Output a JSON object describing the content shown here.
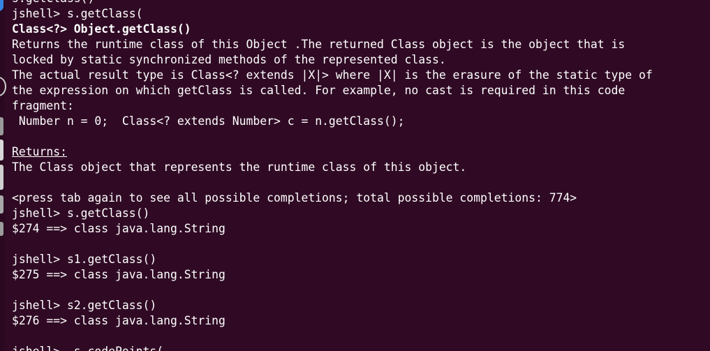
{
  "terminal": {
    "lines": [
      {
        "text": "s.getClass()",
        "style": "partial"
      },
      {
        "text": "jshell> s.getClass(",
        "style": "normal"
      },
      {
        "text": "Class<?> Object.getClass()",
        "style": "bold"
      },
      {
        "text": "Returns the runtime class of this Object .The returned Class object is the object that is",
        "style": "normal"
      },
      {
        "text": "locked by static synchronized methods of the represented class.",
        "style": "normal"
      },
      {
        "text": "The actual result type is Class<? extends |X|> where |X| is the erasure of the static type of",
        "style": "normal"
      },
      {
        "text": "the expression on which getClass is called. For example, no cast is required in this code",
        "style": "normal"
      },
      {
        "text": "fragment:",
        "style": "normal"
      },
      {
        "text": " Number n = 0;  Class<? extends Number> c = n.getClass();",
        "style": "normal"
      },
      {
        "text": "",
        "style": "normal"
      },
      {
        "text": "Returns:",
        "style": "underline"
      },
      {
        "text": "The Class object that represents the runtime class of this object.",
        "style": "normal"
      },
      {
        "text": "",
        "style": "normal"
      },
      {
        "text": "<press tab again to see all possible completions; total possible completions: 774>",
        "style": "normal"
      },
      {
        "text": "jshell> s.getClass()",
        "style": "normal"
      },
      {
        "text": "$274 ==> class java.lang.String",
        "style": "normal"
      },
      {
        "text": "",
        "style": "normal"
      },
      {
        "text": "jshell> s1.getClass()",
        "style": "normal"
      },
      {
        "text": "$275 ==> class java.lang.String",
        "style": "normal"
      },
      {
        "text": "",
        "style": "normal"
      },
      {
        "text": "jshell> s2.getClass()",
        "style": "normal"
      },
      {
        "text": "$276 ==> class java.lang.String",
        "style": "normal"
      },
      {
        "text": "",
        "style": "normal"
      },
      {
        "text": "jshell>  s.codePoints(",
        "style": "normal"
      }
    ]
  },
  "colors": {
    "background": "#300a24",
    "foreground": "#ffffff"
  }
}
